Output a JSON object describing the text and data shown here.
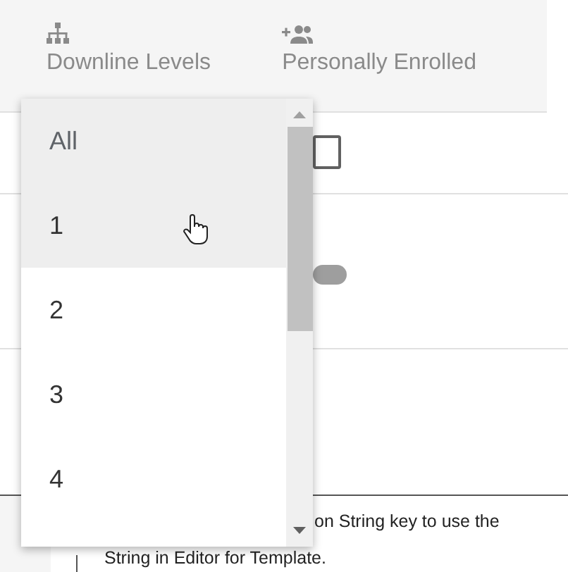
{
  "columns": [
    {
      "kind": "levels",
      "label": "Downline Levels"
    },
    {
      "kind": "enrolled",
      "label": "Personally Enrolled"
    }
  ],
  "row_checkbox": {
    "checked": false
  },
  "row_toggle": {
    "on": false
  },
  "help_text": {
    "line_1": "on String key to use the",
    "line_2": "String in Editor for Template."
  },
  "dropdown": {
    "items": [
      {
        "label": "All",
        "selected": true,
        "hovered": false
      },
      {
        "label": "1",
        "selected": false,
        "hovered": true
      },
      {
        "label": "2",
        "selected": false,
        "hovered": false
      },
      {
        "label": "3",
        "selected": false,
        "hovered": false
      },
      {
        "label": "4",
        "selected": false,
        "hovered": false
      }
    ]
  }
}
